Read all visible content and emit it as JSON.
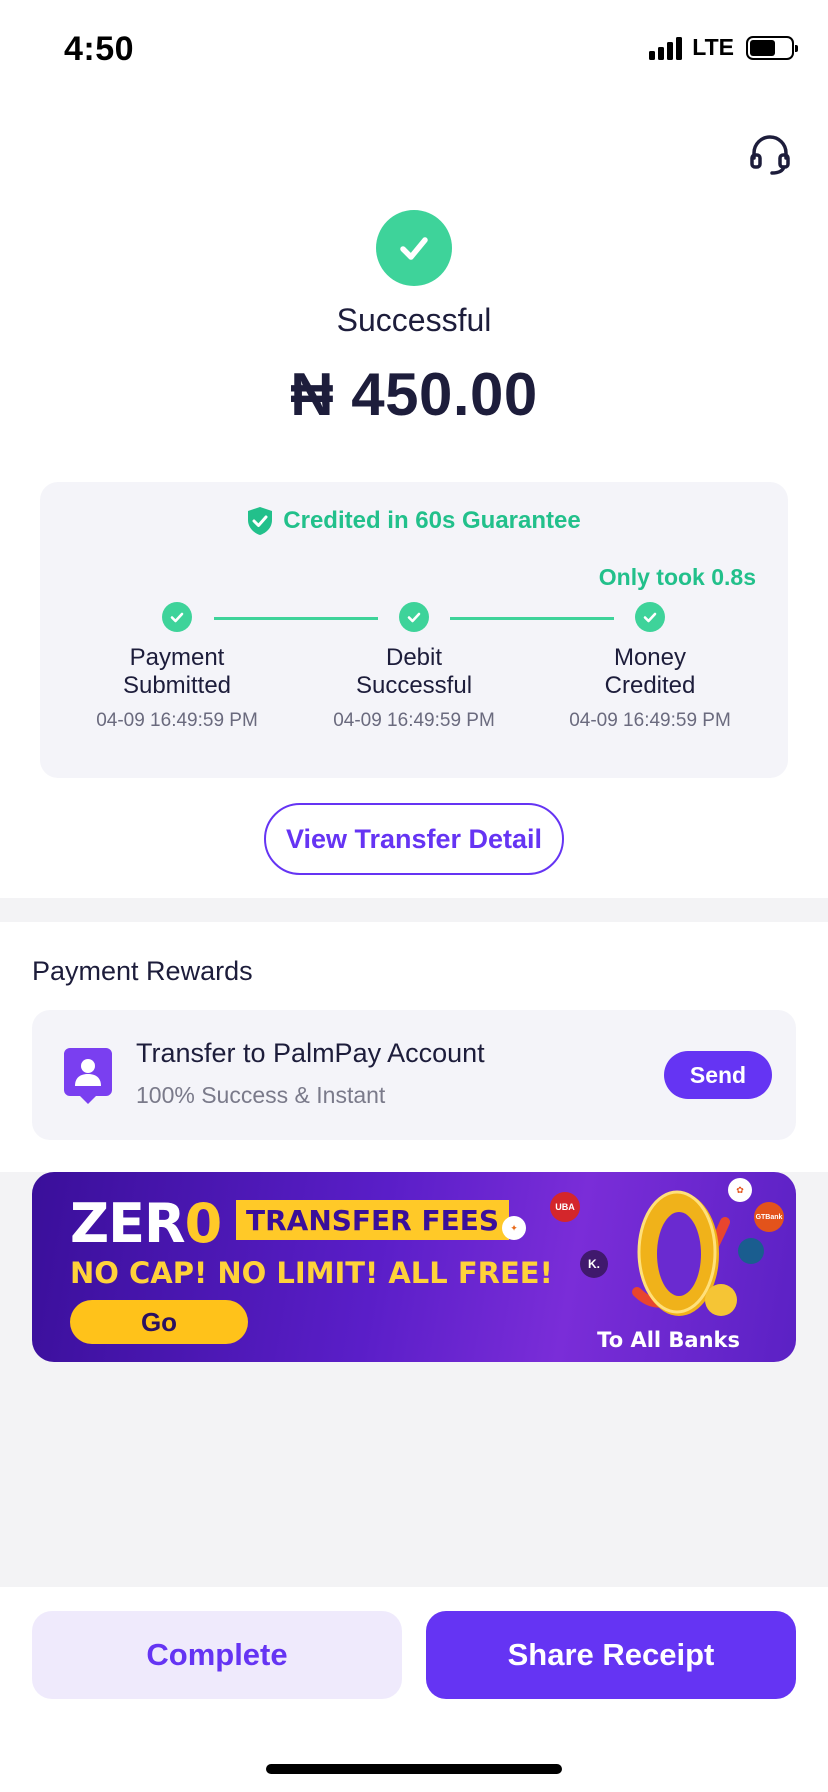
{
  "status_bar": {
    "time": "4:50",
    "network": "LTE",
    "battery_level": 0.62
  },
  "result": {
    "status": "Successful",
    "amount": "₦ 450.00"
  },
  "progress": {
    "guarantee": "Credited in 60s Guarantee",
    "took": "Only took 0.8s",
    "steps": [
      {
        "label": "Payment Submitted",
        "time": "04-09 16:49:59 PM"
      },
      {
        "label": "Debit Successful",
        "time": "04-09 16:49:59 PM"
      },
      {
        "label": "Money Credited",
        "time": "04-09 16:49:59 PM"
      }
    ]
  },
  "view_detail_label": "View Transfer Detail",
  "rewards": {
    "title": "Payment Rewards",
    "item": {
      "title": "Transfer to PalmPay Account",
      "subtitle": "100% Success & Instant",
      "action": "Send"
    }
  },
  "banner": {
    "zero_word_prefix": "ZER",
    "zero_word_o": "0",
    "fees": "TRANSFER FEES",
    "tagline": "NO CAP! NO LIMIT! ALL FREE!",
    "cta": "Go",
    "footer": "To All Banks",
    "bank_badges": [
      "UBA",
      "K.",
      "GTBank"
    ]
  },
  "bottom": {
    "complete": "Complete",
    "share": "Share Receipt"
  },
  "colors": {
    "primary": "#6534f3",
    "success": "#3ed39a",
    "success_text": "#22c08b"
  }
}
